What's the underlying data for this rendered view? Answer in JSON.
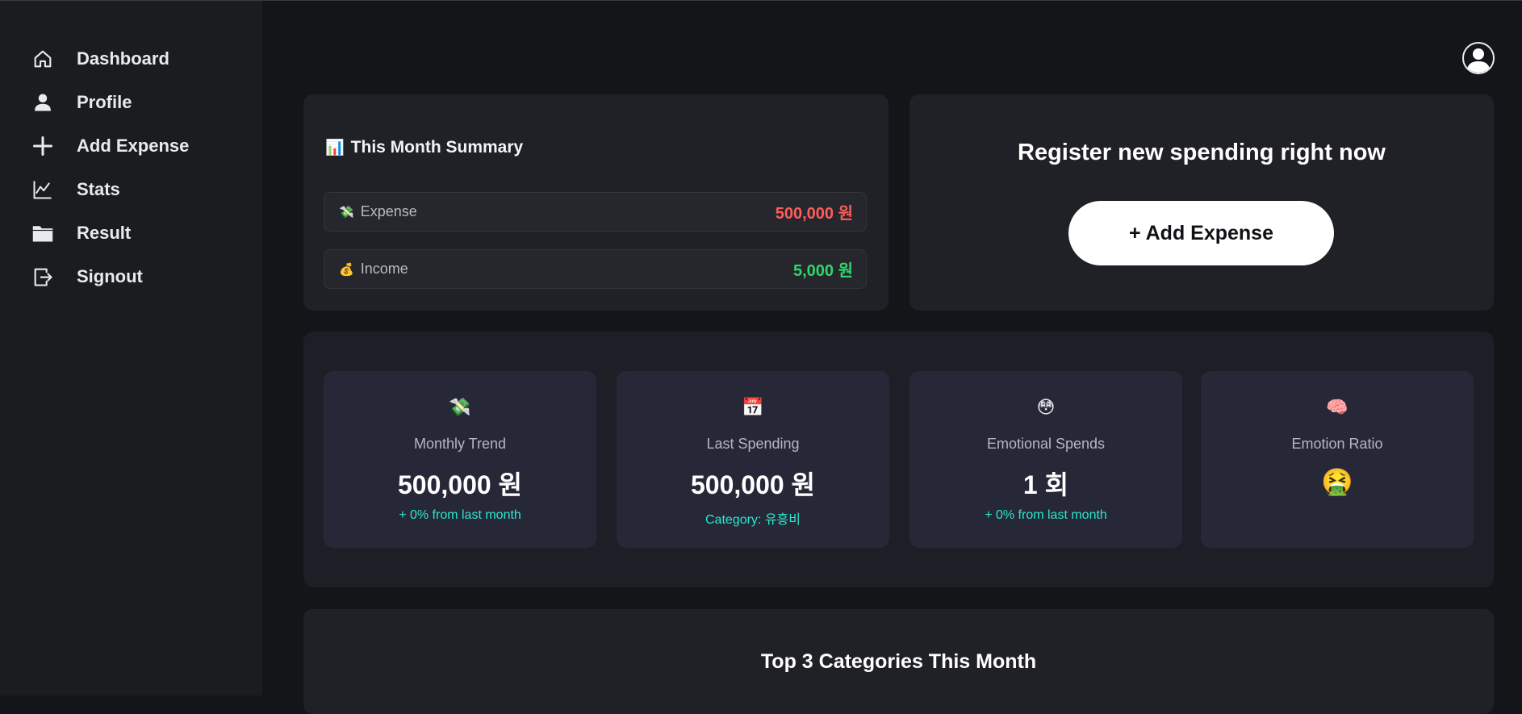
{
  "sidebar": {
    "items": [
      {
        "label": "Dashboard",
        "icon": "home-icon"
      },
      {
        "label": "Profile",
        "icon": "user-icon"
      },
      {
        "label": "Add Expense",
        "icon": "plus-icon"
      },
      {
        "label": "Stats",
        "icon": "chart-line-icon"
      },
      {
        "label": "Result",
        "icon": "folder-icon"
      },
      {
        "label": "Signout",
        "icon": "signout-icon"
      }
    ]
  },
  "summary": {
    "emoji": "📊",
    "title": "This Month Summary",
    "expense": {
      "emoji": "💸",
      "label": "Expense",
      "value": "500,000 원"
    },
    "income": {
      "emoji": "💰",
      "label": "Income",
      "value": "5,000 원"
    }
  },
  "register": {
    "title": "Register new spending right now",
    "button_label": "+ Add Expense"
  },
  "stats": [
    {
      "emoji": "💸",
      "title": "Monthly Trend",
      "value": "500,000 원",
      "sub": "+ 0% from last month"
    },
    {
      "emoji": "📅",
      "title": "Last Spending",
      "value": "500,000 원",
      "sub": "Category: 유흥비"
    },
    {
      "emoji": "😳",
      "title": "Emotional Spends",
      "value": "1 회",
      "sub": "+ 0% from last month"
    },
    {
      "emoji": "🧠",
      "title": "Emotion Ratio",
      "value_emoji": "🤮"
    }
  ],
  "top3": {
    "title": "Top 3 Categories This Month"
  },
  "colors": {
    "expense": "#ff5c5c",
    "income": "#2fd66d",
    "accent_sub": "#2de6cf"
  }
}
